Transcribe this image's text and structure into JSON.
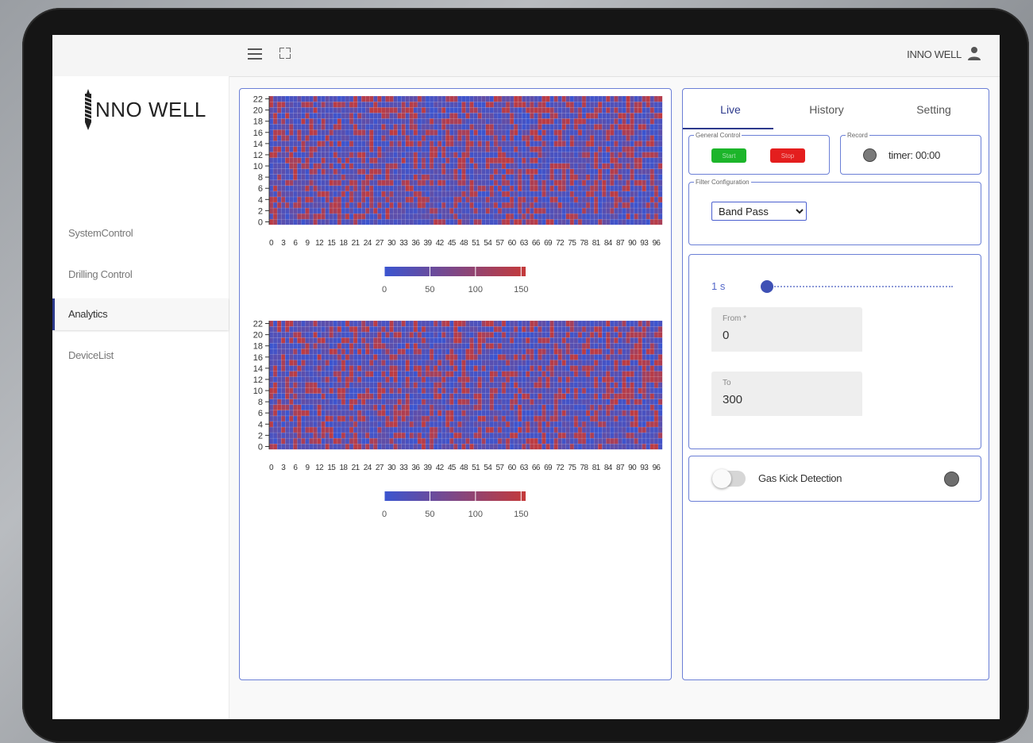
{
  "brand": {
    "logo_text": "NNO WELL",
    "logo_icon": "drill-bit-icon"
  },
  "topbar": {
    "menu_icon": "hamburger-menu-icon",
    "fullscreen_icon": "fullscreen-icon",
    "user_name": "INNO WELL",
    "user_icon": "person-icon"
  },
  "sidebar": {
    "items": [
      {
        "label": "SystemControl",
        "active": false
      },
      {
        "label": "Drilling Control",
        "active": false
      },
      {
        "label": "Analytics",
        "active": true
      },
      {
        "label": "DeviceList",
        "active": false
      }
    ],
    "active_accent": "#2d3a8c"
  },
  "chart_data": [
    {
      "type": "heatmap",
      "x_ticks": [
        "0",
        "3",
        "6",
        "9",
        "12",
        "15",
        "18",
        "21",
        "24",
        "27",
        "30",
        "33",
        "36",
        "39",
        "42",
        "45",
        "48",
        "51",
        "54",
        "57",
        "60",
        "63",
        "66",
        "69",
        "72",
        "75",
        "78",
        "81",
        "84",
        "87",
        "90",
        "93",
        "96"
      ],
      "y_ticks": [
        "0",
        "2",
        "4",
        "6",
        "8",
        "10",
        "12",
        "14",
        "16",
        "18",
        "20",
        "22"
      ],
      "xlim": [
        0,
        98
      ],
      "ylim": [
        0,
        23
      ],
      "colorbar": {
        "ticks": [
          "0",
          "50",
          "100",
          "150"
        ],
        "range": [
          0,
          155
        ],
        "low_color": "#3b55d0",
        "high_color": "#c43a3a"
      }
    },
    {
      "type": "heatmap",
      "x_ticks": [
        "0",
        "3",
        "6",
        "9",
        "12",
        "15",
        "18",
        "21",
        "24",
        "27",
        "30",
        "33",
        "36",
        "39",
        "42",
        "45",
        "48",
        "51",
        "54",
        "57",
        "60",
        "63",
        "66",
        "69",
        "72",
        "75",
        "78",
        "81",
        "84",
        "87",
        "90",
        "93",
        "96"
      ],
      "y_ticks": [
        "0",
        "2",
        "4",
        "6",
        "8",
        "10",
        "12",
        "14",
        "16",
        "18",
        "20",
        "22"
      ],
      "xlim": [
        0,
        98
      ],
      "ylim": [
        0,
        23
      ],
      "colorbar": {
        "ticks": [
          "0",
          "50",
          "100",
          "150"
        ],
        "range": [
          0,
          155
        ],
        "low_color": "#3b55d0",
        "high_color": "#c43a3a"
      }
    }
  ],
  "panel": {
    "tabs": [
      {
        "label": "Live",
        "active": true
      },
      {
        "label": "History",
        "active": false
      },
      {
        "label": "Setting",
        "active": false
      }
    ],
    "general_control": {
      "legend": "General Control",
      "start_label": "Start",
      "stop_label": "Stop"
    },
    "record": {
      "legend": "Record",
      "timer_text": "timer: 00:00"
    },
    "filter": {
      "legend": "Filter Configuration",
      "selected": "Band Pass"
    },
    "window": {
      "slider_label": "1 s",
      "slider_value": 0.0
    },
    "from": {
      "label": "From *",
      "value": "0"
    },
    "to": {
      "label": "To",
      "value": "300"
    },
    "gas_kick": {
      "label": "Gas Kick Detection",
      "enabled": false
    }
  },
  "colors": {
    "accent": "#3f51b5",
    "border": "#6b7fd6",
    "start": "#1cb52a",
    "stop": "#e41e1e"
  }
}
